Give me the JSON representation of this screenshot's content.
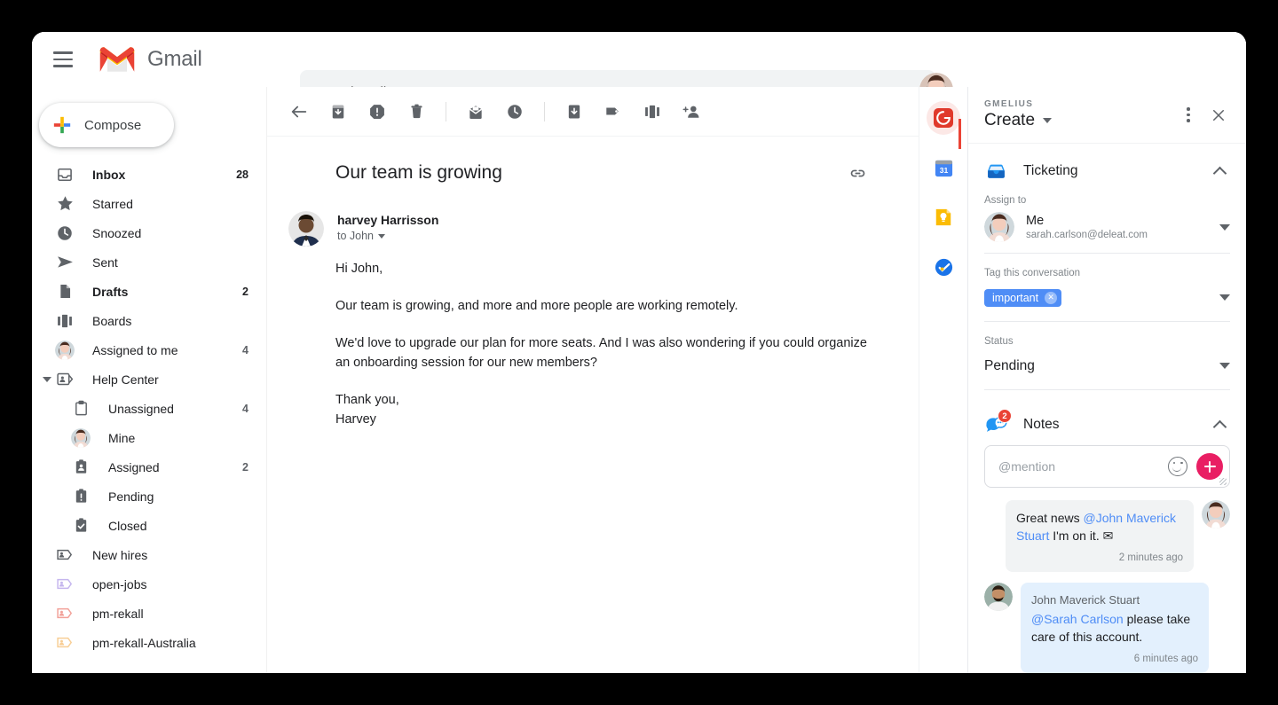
{
  "topbar": {
    "menu_icon": "hamburger-icon",
    "brand": "Gmail",
    "search_value": "",
    "search_placeholder": "Search mail",
    "avatar": "user-avatar"
  },
  "sidebar": {
    "compose_label": "Compose",
    "items": [
      {
        "label": "Inbox",
        "count": "28",
        "icon": "inbox-icon",
        "bold": true,
        "indent": false,
        "caret": false
      },
      {
        "label": "Starred",
        "count": "",
        "icon": "star-icon",
        "bold": false,
        "indent": false,
        "caret": false
      },
      {
        "label": "Snoozed",
        "count": "",
        "icon": "clock-icon",
        "bold": false,
        "indent": false,
        "caret": false
      },
      {
        "label": "Sent",
        "count": "",
        "icon": "send-icon",
        "bold": false,
        "indent": false,
        "caret": false
      },
      {
        "label": "Drafts",
        "count": "2",
        "icon": "draft-icon",
        "bold": true,
        "indent": false,
        "caret": false
      },
      {
        "label": "Boards",
        "count": "",
        "icon": "boards-icon",
        "bold": false,
        "indent": true,
        "caret": false
      },
      {
        "label": "Assigned to me",
        "count": "4",
        "icon": "avatar-icon",
        "bold": false,
        "indent": true,
        "caret": false
      },
      {
        "label": "Help Center",
        "count": "",
        "icon": "tag-person-icon",
        "bold": false,
        "indent": true,
        "caret": true
      },
      {
        "label": "Unassigned",
        "count": "4",
        "icon": "clipboard-icon",
        "bold": false,
        "indent": true,
        "caret": false,
        "deep": true
      },
      {
        "label": "Mine",
        "count": "",
        "icon": "avatar-icon",
        "bold": false,
        "indent": true,
        "caret": false,
        "deep": true
      },
      {
        "label": "Assigned",
        "count": "2",
        "icon": "clipboard-person-icon",
        "bold": false,
        "indent": true,
        "caret": false,
        "deep": true
      },
      {
        "label": "Pending",
        "count": "",
        "icon": "clipboard-alert-icon",
        "bold": false,
        "indent": true,
        "caret": false,
        "deep": true
      },
      {
        "label": "Closed",
        "count": "",
        "icon": "clipboard-check-icon",
        "bold": false,
        "indent": true,
        "caret": false,
        "deep": true
      },
      {
        "label": "New hires",
        "count": "",
        "icon": "label-icon-gray",
        "bold": false,
        "indent": true,
        "caret": false
      },
      {
        "label": "open-jobs",
        "count": "",
        "icon": "label-icon-purple",
        "bold": false,
        "indent": true,
        "caret": false
      },
      {
        "label": "pm-rekall",
        "count": "",
        "icon": "label-icon-red",
        "bold": false,
        "indent": true,
        "caret": false
      },
      {
        "label": "pm-rekall-Australia",
        "count": "",
        "icon": "label-icon-orange",
        "bold": false,
        "indent": true,
        "caret": false
      }
    ]
  },
  "mail": {
    "toolbar": [
      {
        "name": "back-arrow-icon",
        "sep_after": false
      },
      {
        "name": "archive-icon",
        "sep_after": false
      },
      {
        "name": "report-spam-icon",
        "sep_after": false
      },
      {
        "name": "delete-icon",
        "sep_after": true
      },
      {
        "name": "mark-unread-icon",
        "sep_after": false
      },
      {
        "name": "snooze-icon",
        "sep_after": true
      },
      {
        "name": "move-to-icon",
        "sep_after": false
      },
      {
        "name": "labels-icon",
        "sep_after": false
      },
      {
        "name": "boards-icon",
        "sep_after": false
      },
      {
        "name": "assign-icon",
        "sep_after": false
      }
    ],
    "subject": "Our team is growing",
    "link_icon": "link-icon",
    "sender_name": "harvey Harrisson",
    "sender_to": "to John",
    "paragraphs": [
      "Hi John,",
      "Our team is growing, and more and more people are working remotely.",
      "We'd love to upgrade our plan for more seats. And I was also wondering if you could organize an onboarding session for our new members?",
      "Thank you,\nHarvey"
    ]
  },
  "apps_strip": [
    {
      "name": "gmelius-icon",
      "active": true
    },
    {
      "name": "calendar-icon",
      "active": false,
      "day": "31"
    },
    {
      "name": "keep-icon",
      "active": false
    },
    {
      "name": "tasks-icon",
      "active": false
    }
  ],
  "gmelius": {
    "brand": "GMELIUS",
    "title": "Create",
    "more_icon": "more-vertical-icon",
    "close_icon": "close-icon",
    "ticketing": {
      "icon": "ticket-inbox-icon",
      "title": "Ticketing",
      "collapse_icon": "chevron-up-icon",
      "assign_label": "Assign to",
      "assign_name": "Me",
      "assign_email": "sarah.carlson@deleat.com",
      "tag_label": "Tag this conversation",
      "tag_value": "important",
      "tag_remove_icon": "remove-tag-icon",
      "tag_color": "#4f8df6",
      "status_label": "Status",
      "status_value": "Pending"
    },
    "notes": {
      "icon": "notes-chat-icon",
      "title": "Notes",
      "badge": "2",
      "collapse_icon": "chevron-up-icon",
      "input_value": "",
      "input_placeholder": "@mention",
      "emoji_icon": "emoji-icon",
      "add_icon": "add-note-icon",
      "items": [
        {
          "side": "mine",
          "author": "",
          "pre": "Great news ",
          "mention": "@John Maverick Stuart",
          "post": " I'm on it. ✉",
          "time": "2 minutes ago"
        },
        {
          "side": "other",
          "author": "John Maverick Stuart",
          "pre": "",
          "mention": "@Sarah Carlson",
          "post": " please take care of this account.",
          "time": "6 minutes ago"
        }
      ]
    }
  }
}
